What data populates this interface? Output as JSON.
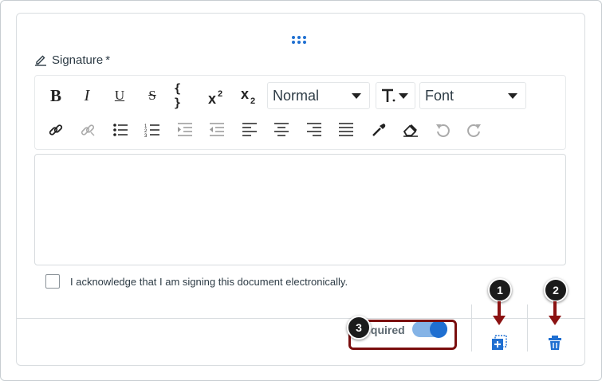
{
  "field": {
    "title": "Signature",
    "required_marker": "*"
  },
  "toolbar": {
    "row1": [
      "bold-icon",
      "italic-icon",
      "underline-icon",
      "strikethrough-icon",
      "code-braces-icon",
      "superscript-icon",
      "subscript-icon"
    ],
    "format_select": {
      "value": "Normal"
    },
    "font_select": {
      "value": "Font"
    },
    "row2": [
      "link-icon",
      "unlink-icon",
      "bullet-list-icon",
      "numbered-list-icon",
      "indent-icon",
      "outdent-icon",
      "align-left-icon",
      "align-center-icon",
      "align-right-icon",
      "align-justify-icon",
      "color-picker-icon",
      "clear-format-icon",
      "undo-icon",
      "redo-icon"
    ]
  },
  "acknowledge": {
    "label": "I acknowledge that I am signing this document electronically."
  },
  "footer": {
    "required_label": "Required",
    "required_on": true
  },
  "callouts": [
    "1",
    "2",
    "3"
  ],
  "colors": {
    "accent": "#1f6fd1",
    "callout": "#8b1212"
  }
}
